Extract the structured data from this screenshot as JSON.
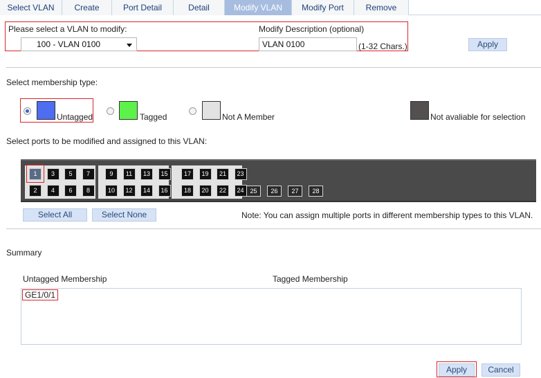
{
  "tabs": [
    "Select VLAN",
    "Create",
    "Port Detail",
    "Detail",
    "Modify VLAN",
    "Modify Port",
    "Remove"
  ],
  "active_tab": "Modify VLAN",
  "vlan_select": {
    "label": "Please select a VLAN to modify:",
    "value": "100 - VLAN 0100"
  },
  "description": {
    "label": "Modify Description (optional)",
    "value": "VLAN 0100",
    "hint": "(1-32 Chars.)"
  },
  "top_apply": "Apply",
  "membership": {
    "label": "Select membership type:",
    "options": [
      {
        "label": "Untagged",
        "color": "#4f6df0",
        "checked": true
      },
      {
        "label": "Tagged",
        "color": "#5cf24a",
        "checked": false
      },
      {
        "label": "Not A Member",
        "color": "#e2e2e2",
        "checked": false
      }
    ],
    "unavailable": {
      "label": "Not avaliable for selection",
      "color": "#555050"
    }
  },
  "ports_label": "Select ports to be modified and assigned to this VLAN:",
  "ports": {
    "top": [
      "1",
      "3",
      "5",
      "7",
      "9",
      "11",
      "13",
      "15",
      "17",
      "19",
      "21",
      "23"
    ],
    "bottom": [
      "2",
      "4",
      "6",
      "8",
      "10",
      "12",
      "14",
      "16",
      "18",
      "20",
      "22",
      "24"
    ],
    "sfp": [
      "25",
      "26",
      "27",
      "28"
    ],
    "selected": [
      "1"
    ]
  },
  "select_all": "Select All",
  "select_none": "Select None",
  "note": "Note: You can assign multiple ports in different membership types to this VLAN.",
  "summary": {
    "title": "Summary",
    "untagged_header": "Untagged Membership",
    "tagged_header": "Tagged Membership",
    "untagged_value": "GE1/0/1",
    "tagged_value": ""
  },
  "bottom_apply": "Apply",
  "cancel": "Cancel"
}
